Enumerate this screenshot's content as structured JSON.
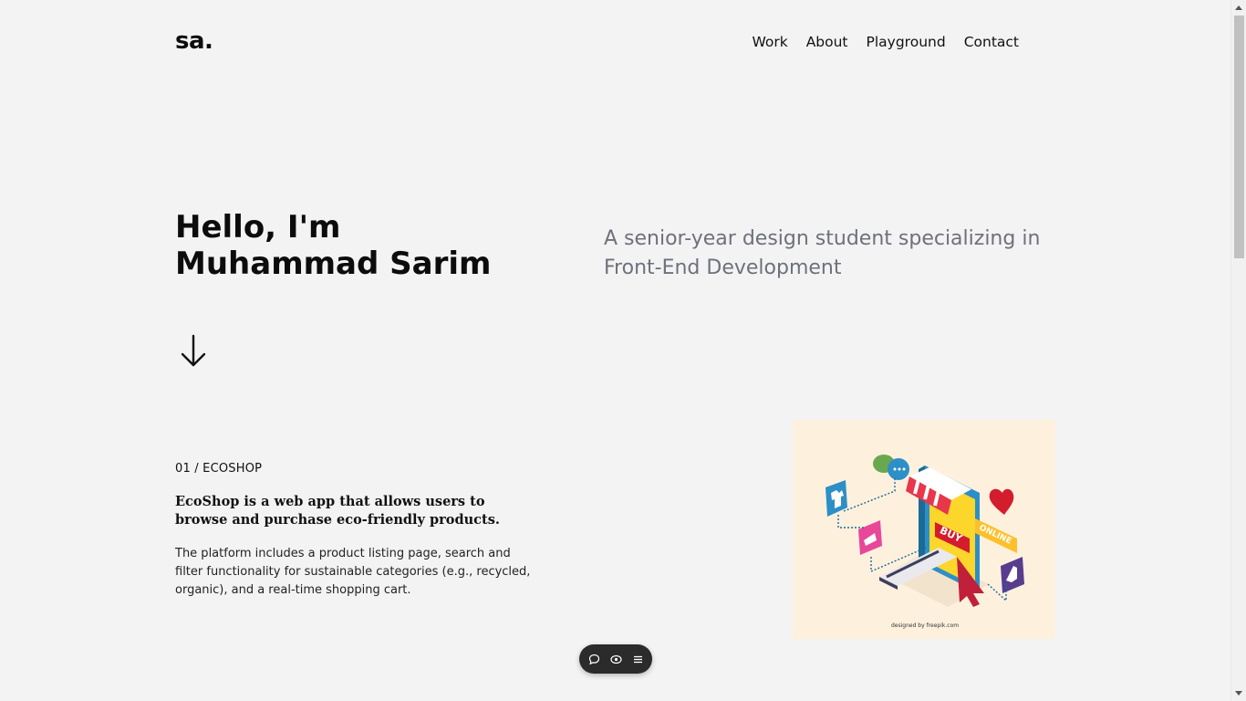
{
  "header": {
    "logo": "sa.",
    "nav": [
      {
        "label": "Work"
      },
      {
        "label": "About"
      },
      {
        "label": "Playground"
      },
      {
        "label": "Contact"
      }
    ]
  },
  "hero": {
    "title_line1": "Hello, I'm",
    "title_line2": "Muhammad Sarim",
    "subtitle_line1": "A senior-year design student specializing in",
    "subtitle_line2": "Front-End Development",
    "scroll_icon": "arrow-down-icon"
  },
  "project": {
    "label": "01 / ECOSHOP",
    "headline": "EcoShop is a web app that allows users to browse and purchase eco-friendly products.",
    "description": "The platform includes a product listing page, search and filter functionality for sustainable categories (e.g., recycled, organic), and a real-time shopping cart.",
    "image": {
      "buy_text": "BUY",
      "online_text": "ONLINE",
      "credit": "designed by freepik.com"
    }
  },
  "toolbar": {
    "icons": [
      "comment-icon",
      "eye-icon",
      "menu-icon"
    ]
  },
  "colors": {
    "background": "#f3f3f3",
    "subtitle": "#6e717c",
    "image_bg": "#fdf1de",
    "toolbar_bg": "#2b2b2b"
  }
}
